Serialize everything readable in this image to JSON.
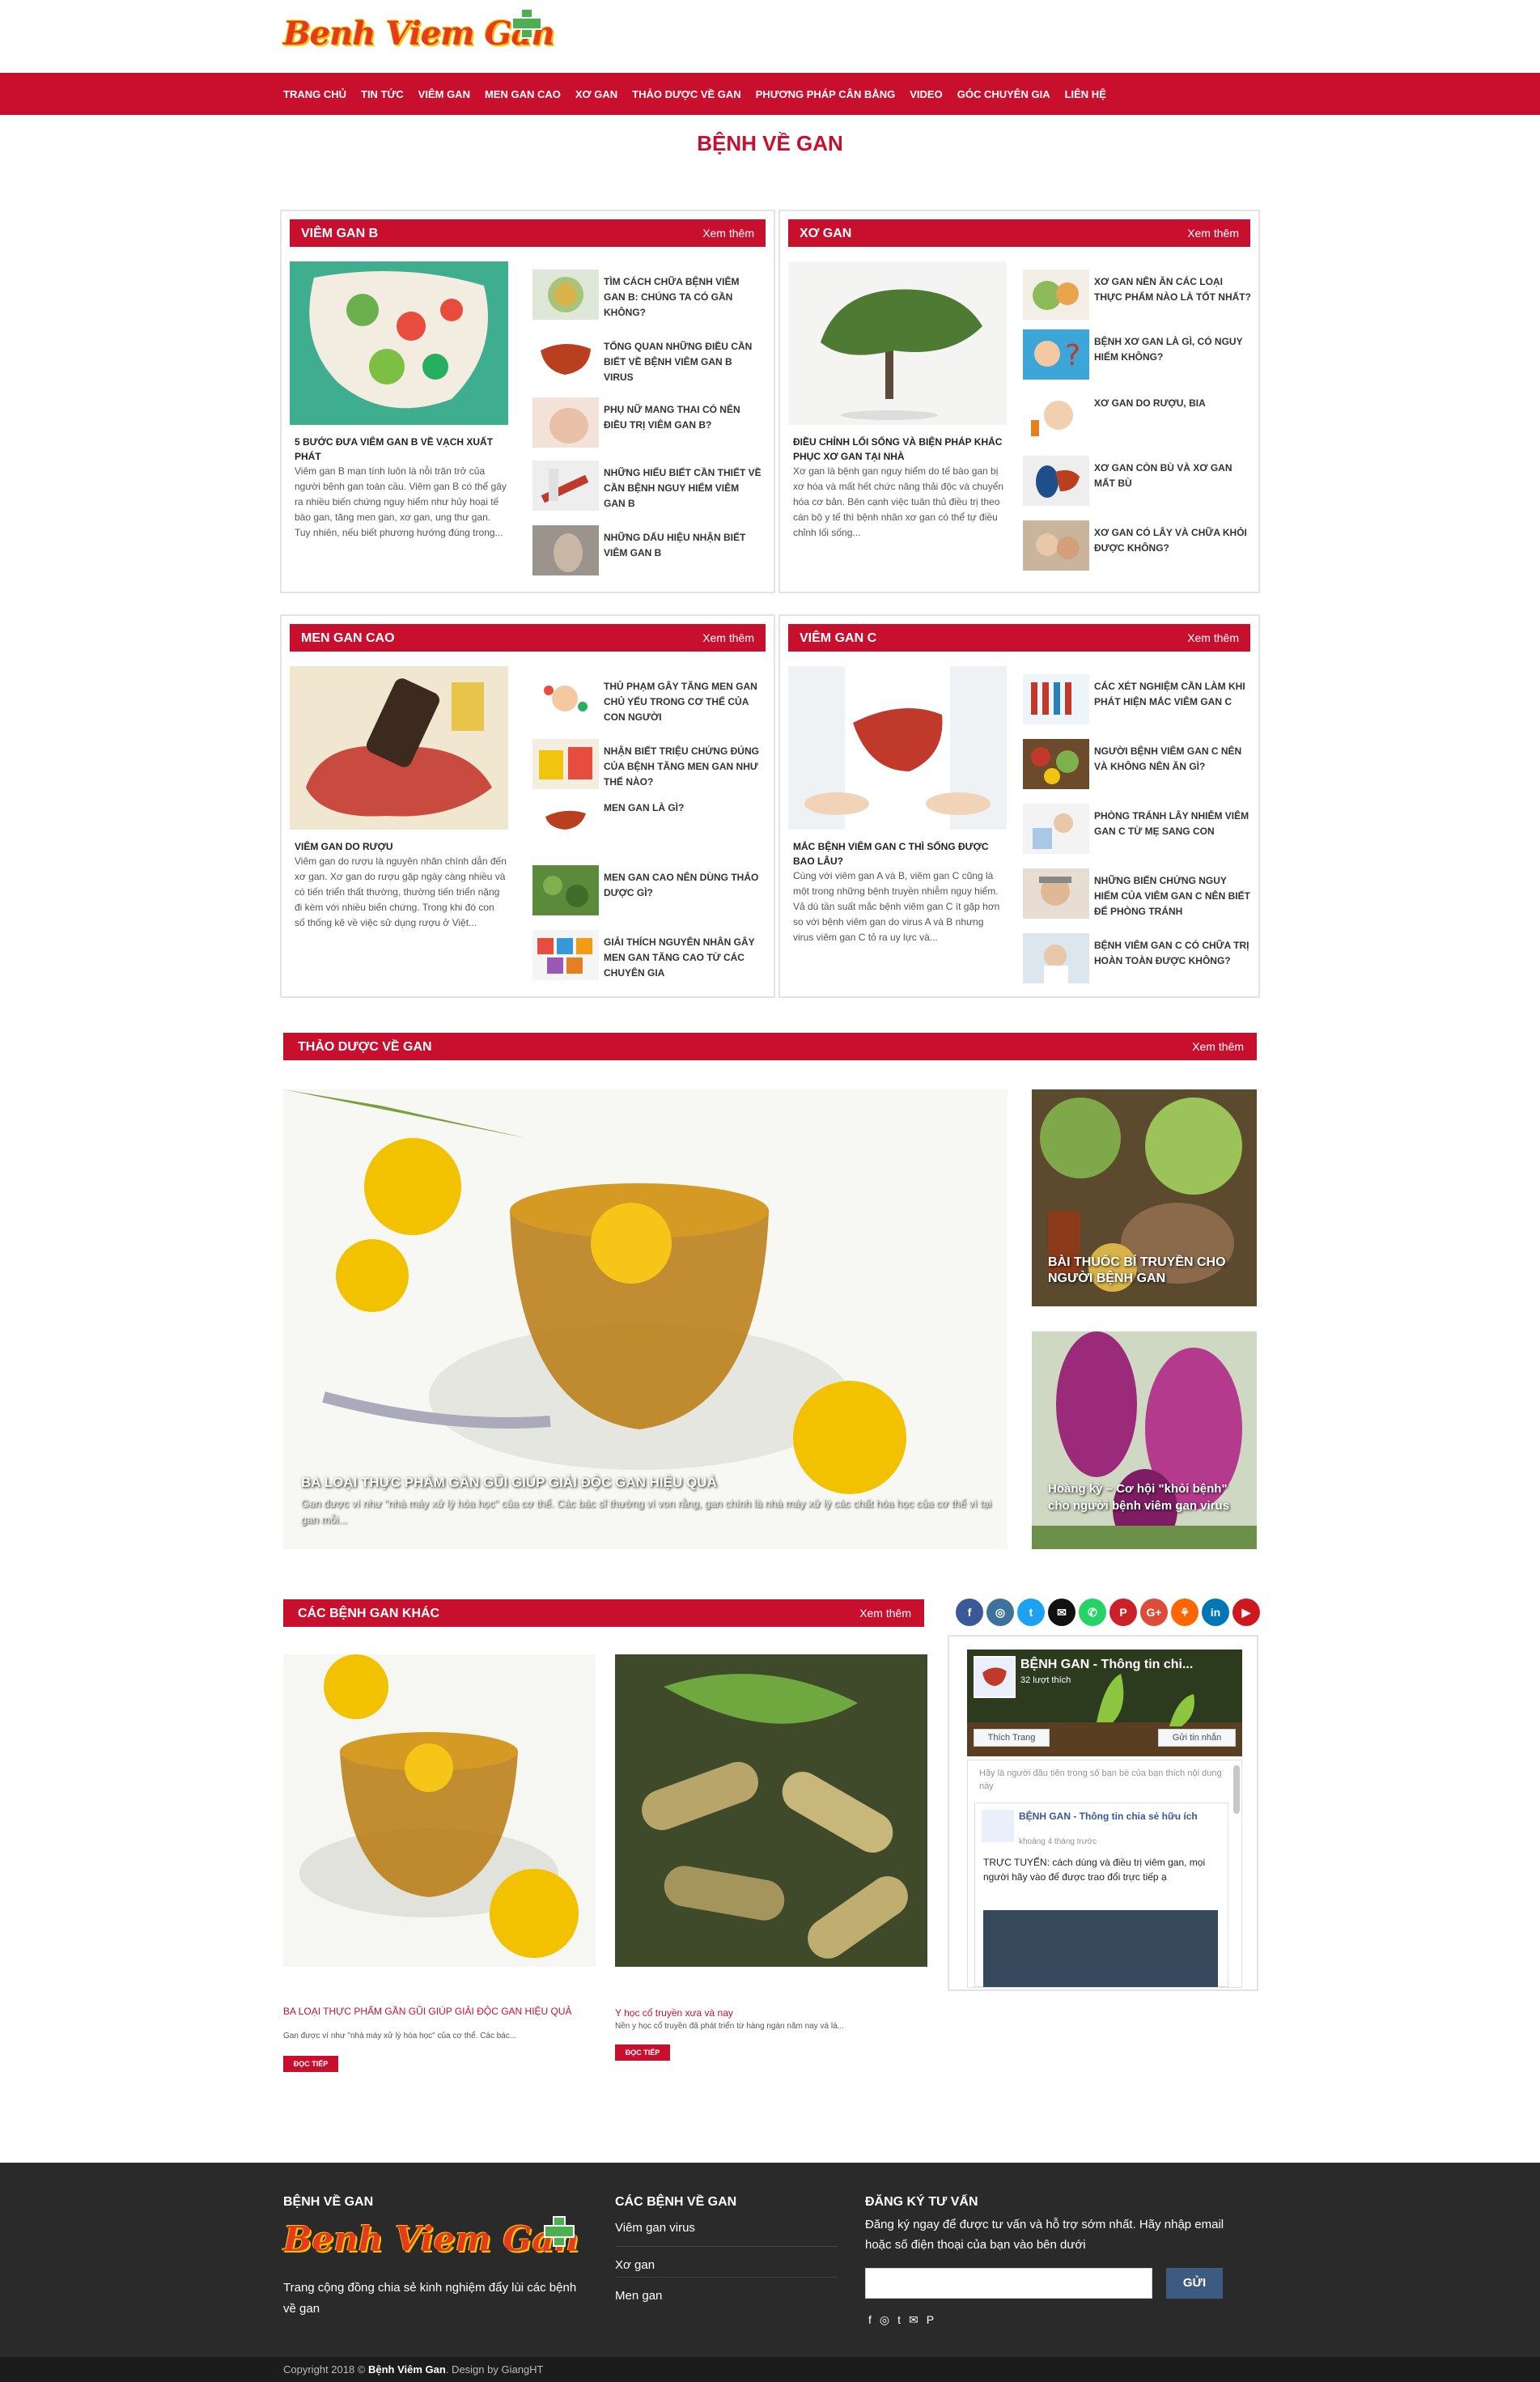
{
  "logo": {
    "text": "Benh Viem Gan"
  },
  "nav": [
    "TRANG CHỦ",
    "TIN TỨC",
    "VIÊM GAN",
    "MEN GAN CAO",
    "XƠ GAN",
    "THẢO DƯỢC VỀ GAN",
    "PHƯƠNG PHÁP CÂN BẰNG",
    "VIDEO",
    "GÓC CHUYÊN GIA",
    "LIÊN HỆ"
  ],
  "page_title": "BỆNH VỀ GAN",
  "more_label": "Xem thêm",
  "panels": [
    {
      "title": "VIÊM GAN B",
      "main_title": "5 BƯỚC ĐƯA VIÊM GAN B VỀ VẠCH XUẤT PHÁT",
      "main_desc": "Viêm gan B mạn tính luôn là nỗi trăn trở của người bệnh gan toàn cầu. Viêm gan B có thể gây ra nhiều biến chứng nguy hiểm như hủy hoại tế bào gan, tăng men gan, xơ gan, ung thư gan. Tuy nhiên, nếu biết phương hướng đúng trong...",
      "items": [
        "TÌM CÁCH CHỮA BỆNH VIÊM GAN B: CHÚNG TA CÓ GẦN KHÔNG?",
        "TỔNG QUAN NHỮNG ĐIỀU CẦN BIẾT VỀ BỆNH VIÊM GAN B VIRUS",
        "PHỤ NỮ MANG THAI CÓ NÊN ĐIỀU TRỊ VIÊM GAN B?",
        "NHỮNG HIỂU BIẾT CẦN THIẾT VỀ CẦN BỆNH NGUY HIỂM VIÊM GAN B",
        "NHỮNG DẤU HIỆU NHẬN BIẾT VIÊM GAN B"
      ]
    },
    {
      "title": "XƠ GAN",
      "main_title": "ĐIỀU CHỈNH LỐI SỐNG VÀ BIỆN PHÁP KHẮC PHỤC XƠ GAN TẠI NHÀ",
      "main_desc": "Xơ gan là bệnh gan nguy hiểm do tế bào gan bị xơ hóa và mất hết chức năng thải độc và chuyển hóa cơ bản. Bên cạnh việc tuân thủ điều trị theo cán bộ y tế thì bệnh nhân xơ gan có thể tự điều chỉnh lối sống...",
      "items": [
        "XƠ GAN NÊN ĂN CÁC LOẠI THỰC PHẨM NÀO LÀ TỐT NHẤT?",
        "BỆNH XƠ GAN LÀ GÌ, CÓ NGUY HIỂM KHÔNG?",
        "XƠ GAN DO RƯỢU, BIA",
        "XƠ GAN CÒN BÙ VÀ XƠ GAN MẤT BÙ",
        "XƠ GAN CÓ LÂY VÀ CHỮA KHỎI ĐƯỢC KHÔNG?"
      ]
    },
    {
      "title": "MEN GAN CAO",
      "main_title": "VIÊM GAN DO RƯỢU",
      "main_desc": "Viêm gan do rượu là nguyên nhân chính dẫn đến xơ gan. Xơ gan do rượu gặp ngày càng nhiều và có tiến triển thất thường, thường tiến triển nặng đi kèm với nhiều biến chứng. Trong khi đó con số thống kê về việc sử dụng rượu ở Việt...",
      "items": [
        "THỦ PHẠM GÂY TĂNG MEN GAN CHỦ YẾU TRONG CƠ THỂ CỦA CON NGƯỜI",
        "NHẬN BIẾT TRIỆU CHỨNG ĐÚNG CỦA BỆNH TĂNG MEN GAN NHƯ THẾ NÀO?",
        "MEN GAN LÀ GÌ?",
        "MEN GAN CAO NÊN DÙNG THẢO DƯỢC GÌ?",
        "GIẢI THÍCH NGUYÊN NHÂN GÂY MEN GAN TĂNG CAO TỪ CÁC CHUYÊN GIA"
      ]
    },
    {
      "title": "VIÊM GAN C",
      "main_title": "MẮC BỆNH VIÊM GAN C THÌ SỐNG ĐƯỢC BAO LÂU?",
      "main_desc": "Cùng với viêm gan A và B, viêm gan C cũng là một trong những bệnh truyền nhiễm nguy hiểm. Vả dù tần suất mắc bệnh viêm gan C ít gặp hơn so với bệnh viêm gan do virus A và B nhưng virus viêm gan C tỏ ra uy lực và...",
      "items": [
        "CÁC XÉT NGHIỆM CẦN LÀM KHI PHÁT HIỆN MẮC VIÊM GAN C",
        "NGƯỜI BỆNH VIÊM GAN C NÊN VÀ KHÔNG NÊN ĂN GÌ?",
        "PHÒNG TRÁNH LÂY NHIỄM VIÊM GAN C TỪ MẸ SANG CON",
        "NHỮNG BIẾN CHỨNG NGUY HIỂM CỦA VIÊM GAN C NÊN BIẾT ĐỂ PHÒNG TRÁNH",
        "BỆNH VIÊM GAN C CÓ CHỮA TRỊ HOÀN TOÀN ĐƯỢC KHÔNG?"
      ]
    }
  ],
  "herbs": {
    "title": "THẢO DƯỢC VỀ GAN",
    "main_title": "BA LOẠI THỰC PHẨM GẦN GŨI GIÚP GIẢI ĐỘC GAN HIỆU QUẢ",
    "main_desc": "Gan được ví như \"nhà máy xử lý hóa học\" của cơ thể. Các bác sĩ thường ví von rằng, gan chính là nhà máy xử lý các chất hóa học của cơ thể vì tại gan mỗi...",
    "side1": "BÀI THUỐC BÍ TRUYỀN CHO NGƯỜI BỆNH GAN",
    "side2": "Hoàng kỳ – Cơ hội \"khỏi bệnh\" cho người bệnh viêm gan virus"
  },
  "other": {
    "title": "CÁC BỆNH GAN KHÁC",
    "cards": [
      {
        "title": "BA LOẠI THỰC PHẨM GẦN GŨI GIÚP GIẢI ĐỘC GAN HIỆU QUẢ",
        "desc": "Gan được ví như \"nhà máy xử lý hóa học\" của cơ thể. Các bác...",
        "btn": "ĐỌC TIẾP"
      },
      {
        "title": "Y học cổ truyền xưa và nay",
        "desc": "Nền y học cổ truyền đã phát triển từ hàng ngàn năm nay và là...",
        "btn": "ĐỌC TIẾP"
      }
    ]
  },
  "fb": {
    "page_name": "BỆNH GAN - Thông tin chi...",
    "likes": "32 lượt thích",
    "like_btn": "Thích Trang",
    "msg_btn": "Gửi tin nhắn",
    "friends_note": "Hãy là người đầu tiên trong số bạn bè của bạn thích nội dung này",
    "post_name": "BỆNH GAN - Thông tin chia sẻ hữu ích",
    "post_time": "khoảng 4 tháng trước",
    "post_text": "TRỰC TUYẾN: cách dùng và điều trị viêm gan, mọi người hãy vào để được trao đổi trực tiếp ạ"
  },
  "social_icons": [
    "f",
    "◎",
    "t",
    "✉",
    "✆",
    "P",
    "G+",
    "⚘",
    "in",
    "▶"
  ],
  "social_colors": [
    "#3b5998",
    "#3f729b",
    "#1da1f2",
    "#111111",
    "#25d366",
    "#cb2027",
    "#dd4b39",
    "#ff6600",
    "#0077b5",
    "#cc181e"
  ],
  "footer": {
    "col1_title": "BỆNH VỀ GAN",
    "col1_desc": "Trang cộng đồng chia sẻ kinh nghiệm đẩy lùi các bệnh về gan",
    "col2_title": "CÁC BỆNH VỀ GAN",
    "col2_links": [
      "Viêm gan virus",
      "Xơ gan",
      "Men gan"
    ],
    "col3_title": "ĐĂNG KÝ TƯ VẤN",
    "col3_desc": "Đăng ký ngay để được tư vấn và hỗ trợ sớm nhất. Hãy nhập email hoặc số điện thoại của bạn vào bên dưới",
    "submit": "GỬI",
    "icons": [
      "f",
      "◎",
      "t",
      "✉",
      "P"
    ]
  },
  "copyright": {
    "pre": "Copyright 2018 © ",
    "brand": "Bệnh Viêm Gan",
    "post": ". Design by GiangHT"
  },
  "colors": {
    "brand_red": "#c8102e",
    "footer_bg": "#2a2a2a"
  }
}
